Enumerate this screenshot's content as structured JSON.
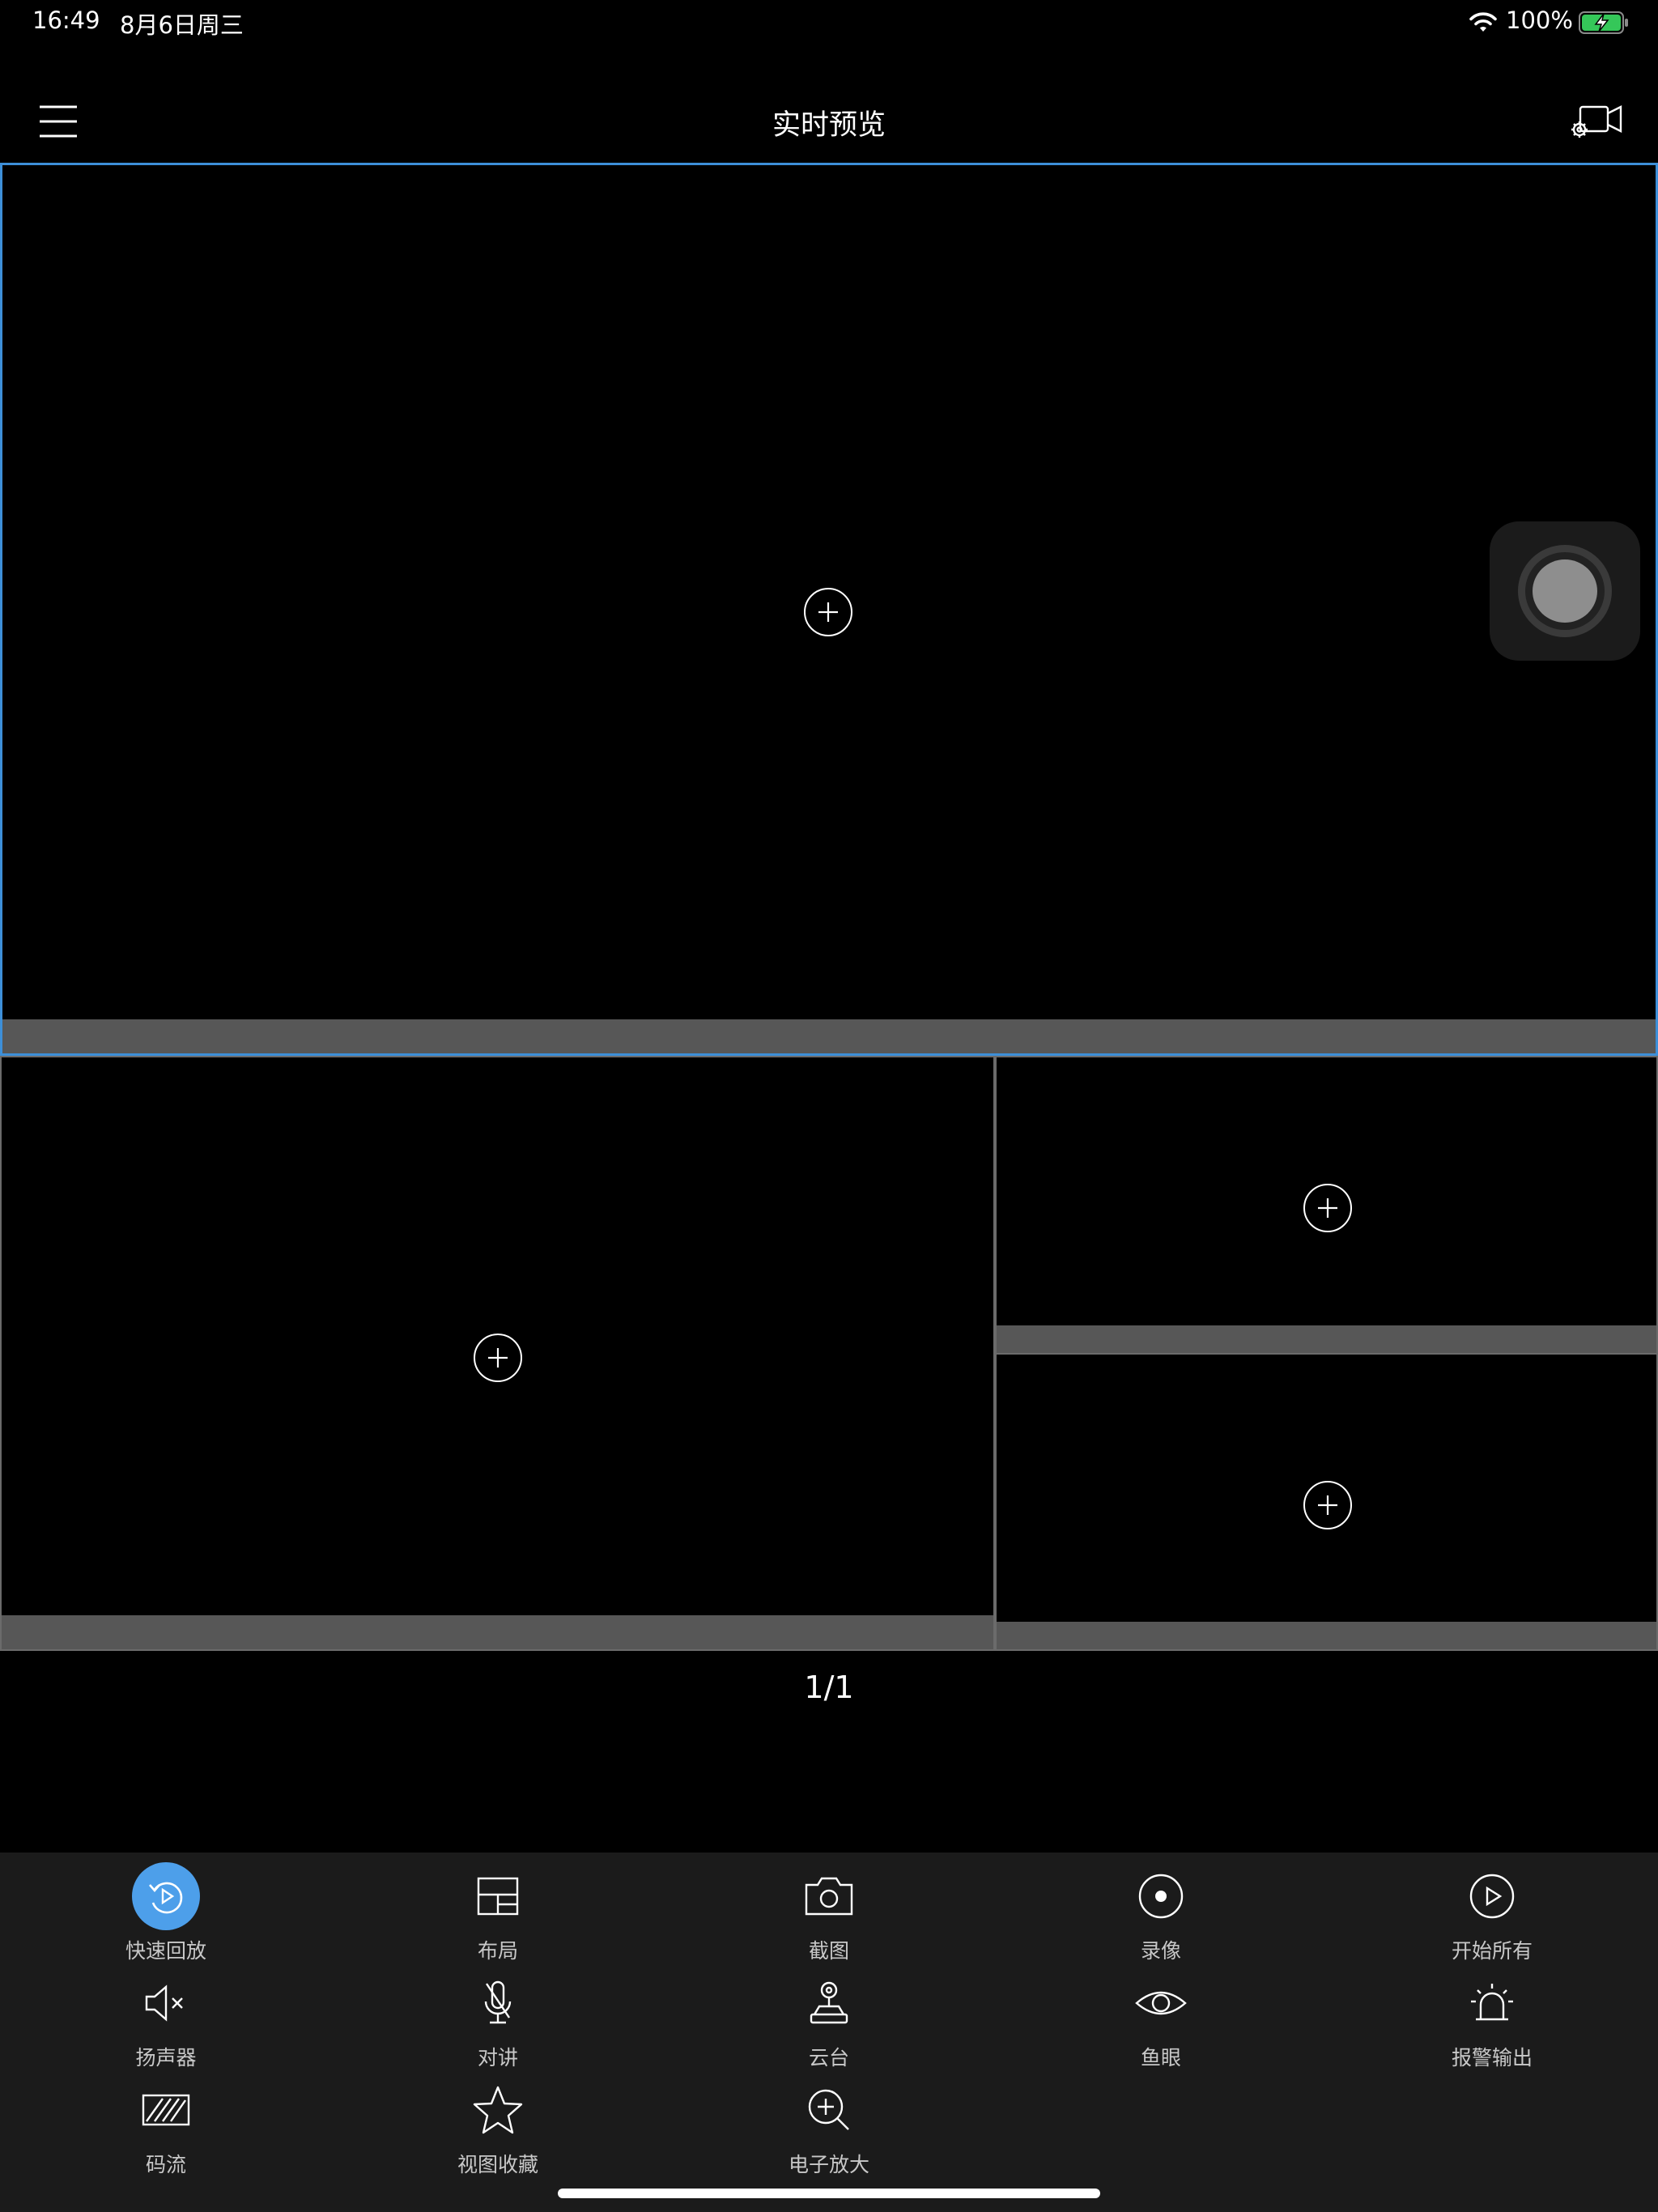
{
  "status_bar": {
    "time": "16:49",
    "date": "8月6日周三",
    "battery_pct": "100%"
  },
  "nav": {
    "title": "实时预览"
  },
  "pagination": {
    "text": "1/1"
  },
  "toolbar": {
    "items": [
      {
        "label": "快速回放",
        "icon": "quick-playback-icon",
        "active": true
      },
      {
        "label": "布局",
        "icon": "layout-icon"
      },
      {
        "label": "截图",
        "icon": "camera-icon"
      },
      {
        "label": "录像",
        "icon": "record-icon"
      },
      {
        "label": "开始所有",
        "icon": "play-all-icon"
      },
      {
        "label": "扬声器",
        "icon": "speaker-mute-icon"
      },
      {
        "label": "对讲",
        "icon": "mic-off-icon"
      },
      {
        "label": "云台",
        "icon": "ptz-icon"
      },
      {
        "label": "鱼眼",
        "icon": "eye-icon"
      },
      {
        "label": "报警输出",
        "icon": "alarm-icon"
      },
      {
        "label": "码流",
        "icon": "stream-icon"
      },
      {
        "label": "视图收藏",
        "icon": "star-icon"
      },
      {
        "label": "电子放大",
        "icon": "zoom-in-icon"
      }
    ]
  },
  "colors": {
    "accent": "#3d8fd8",
    "active_button": "#4d9fea",
    "toolbar_bg": "#1b1b1b",
    "pane_footer": "#575757"
  }
}
